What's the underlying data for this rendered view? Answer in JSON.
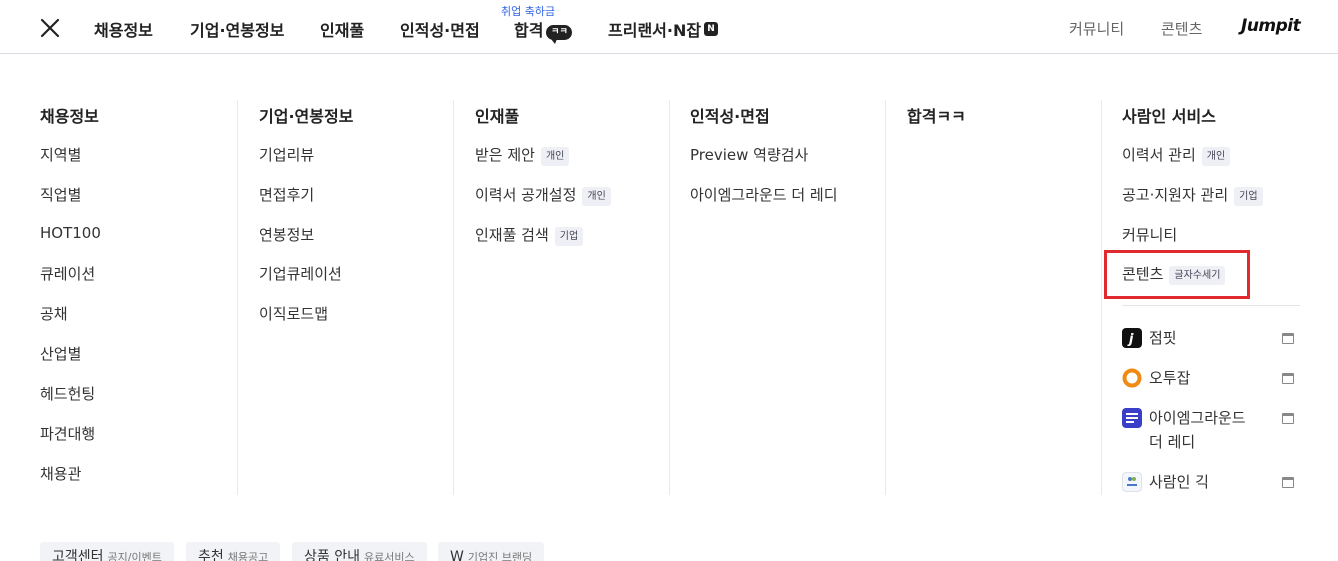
{
  "nav": {
    "items": [
      {
        "label": "채용정보"
      },
      {
        "label": "기업·연봉정보"
      },
      {
        "label": "인재풀"
      },
      {
        "label": "인적성·면접"
      },
      {
        "label": "합격",
        "sub": "취업 축하금",
        "badge": "ㅋㅋ"
      },
      {
        "label": "프리랜서·N잡",
        "badge": "N"
      }
    ],
    "right": {
      "community": "커뮤니티",
      "contents": "콘텐츠",
      "logo": "Jumpit"
    }
  },
  "columns": {
    "jobs": {
      "title": "채용정보",
      "items": [
        "지역별",
        "직업별",
        "HOT100",
        "큐레이션",
        "공채",
        "산업별",
        "헤드헌팅",
        "파견대행",
        "채용관"
      ]
    },
    "company": {
      "title": "기업·연봉정보",
      "items": [
        "기업리뷰",
        "면접후기",
        "연봉정보",
        "기업큐레이션",
        "이직로드맵"
      ]
    },
    "talent": {
      "title": "인재풀",
      "items": [
        {
          "label": "받은 제안",
          "tag": "개인"
        },
        {
          "label": "이력서 공개설정",
          "tag": "개인"
        },
        {
          "label": "인재풀 검색",
          "tag": "기업"
        }
      ]
    },
    "aptitude": {
      "title": "인적성·면접",
      "items": [
        "Preview 역량검사",
        "아이엠그라운드 더 레디"
      ]
    },
    "pass": {
      "title": "합격ㅋㅋ"
    },
    "services": {
      "title": "사람인 서비스",
      "items": [
        {
          "label": "이력서 관리",
          "tag": "개인"
        },
        {
          "label": "공고·지원자 관리",
          "tag": "기업"
        },
        {
          "label": "커뮤니티"
        },
        {
          "label": "콘텐츠",
          "tag": "글자수세기"
        }
      ],
      "external": [
        {
          "label": "점핏",
          "icon": "jumpit-app-icon"
        },
        {
          "label": "오투잡",
          "icon": "otujob-app-icon"
        },
        {
          "label_line1": "아이엠그라운드",
          "label_line2": "더 레디",
          "icon": "imground-app-icon"
        },
        {
          "label": "사람인 긱",
          "icon": "saramin-gig-app-icon"
        }
      ]
    }
  },
  "chips": [
    {
      "label": "고객센터",
      "sub": "공지/이벤트"
    },
    {
      "label": "추천",
      "sub": "채용공고"
    },
    {
      "label": "상품 안내",
      "sub": "유료서비스"
    },
    {
      "label": "W",
      "sub": "기업진 브랜딩"
    }
  ],
  "colors": {
    "accent": "#3064e6",
    "highlight": "#e02a2e",
    "text": "#222222"
  }
}
